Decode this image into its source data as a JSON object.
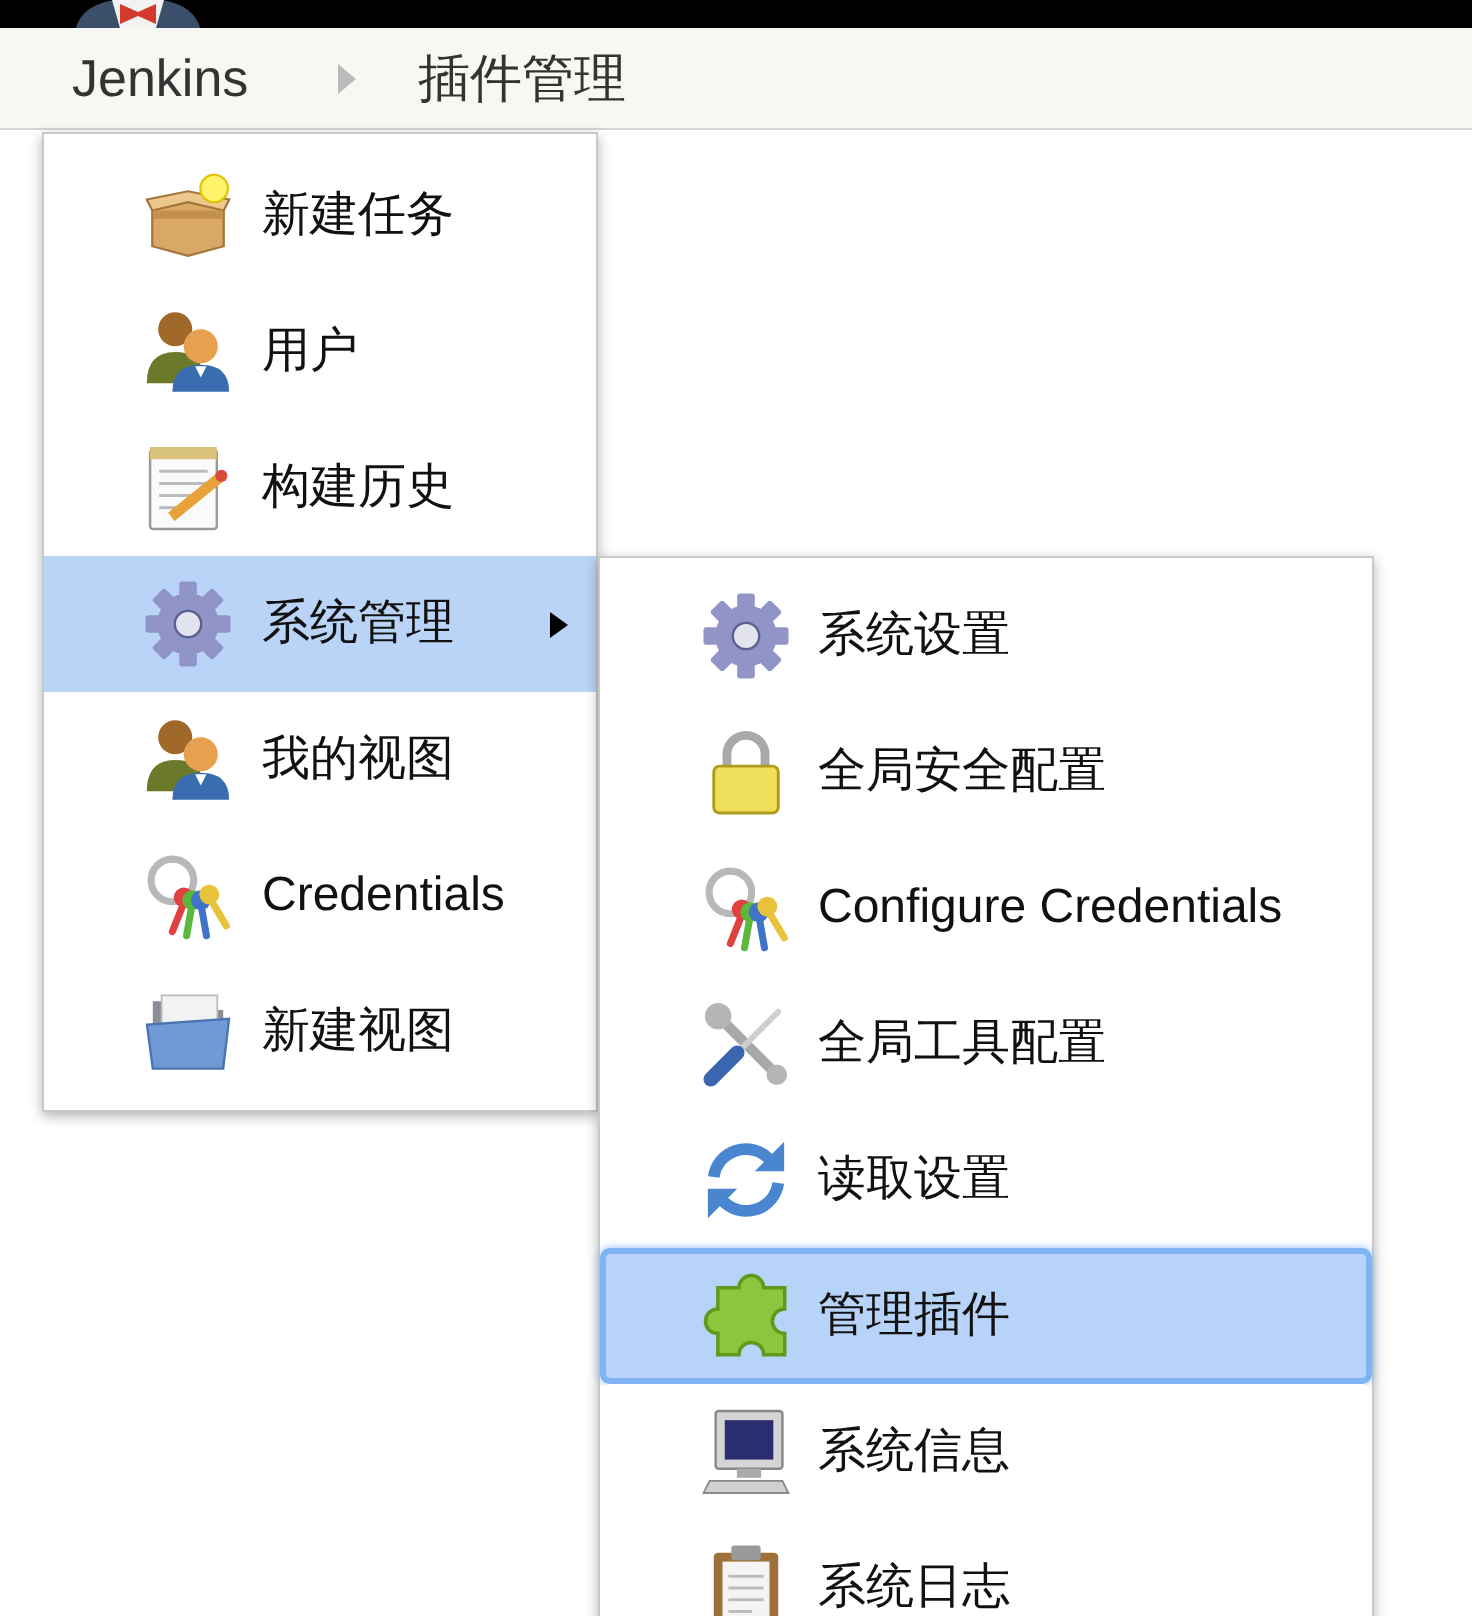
{
  "breadcrumb": [
    {
      "label": "Jenkins"
    },
    {
      "label": "插件管理"
    }
  ],
  "menu": {
    "items": [
      {
        "label": "新建任务",
        "selected": false,
        "has_submenu": false
      },
      {
        "label": "用户",
        "selected": false,
        "has_submenu": false
      },
      {
        "label": "构建历史",
        "selected": false,
        "has_submenu": false
      },
      {
        "label": "系统管理",
        "selected": true,
        "has_submenu": true
      },
      {
        "label": "我的视图",
        "selected": false,
        "has_submenu": false
      },
      {
        "label": "Credentials",
        "selected": false,
        "has_submenu": false
      },
      {
        "label": "新建视图",
        "selected": false,
        "has_submenu": false
      }
    ]
  },
  "submenu": {
    "items": [
      {
        "label": "系统设置",
        "selected": false
      },
      {
        "label": "全局安全配置",
        "selected": false
      },
      {
        "label": "Configure Credentials",
        "selected": false
      },
      {
        "label": "全局工具配置",
        "selected": false
      },
      {
        "label": "读取设置",
        "selected": false
      },
      {
        "label": "管理插件",
        "selected": true
      },
      {
        "label": "系统信息",
        "selected": false
      },
      {
        "label": "系统日志",
        "selected": false
      }
    ]
  }
}
